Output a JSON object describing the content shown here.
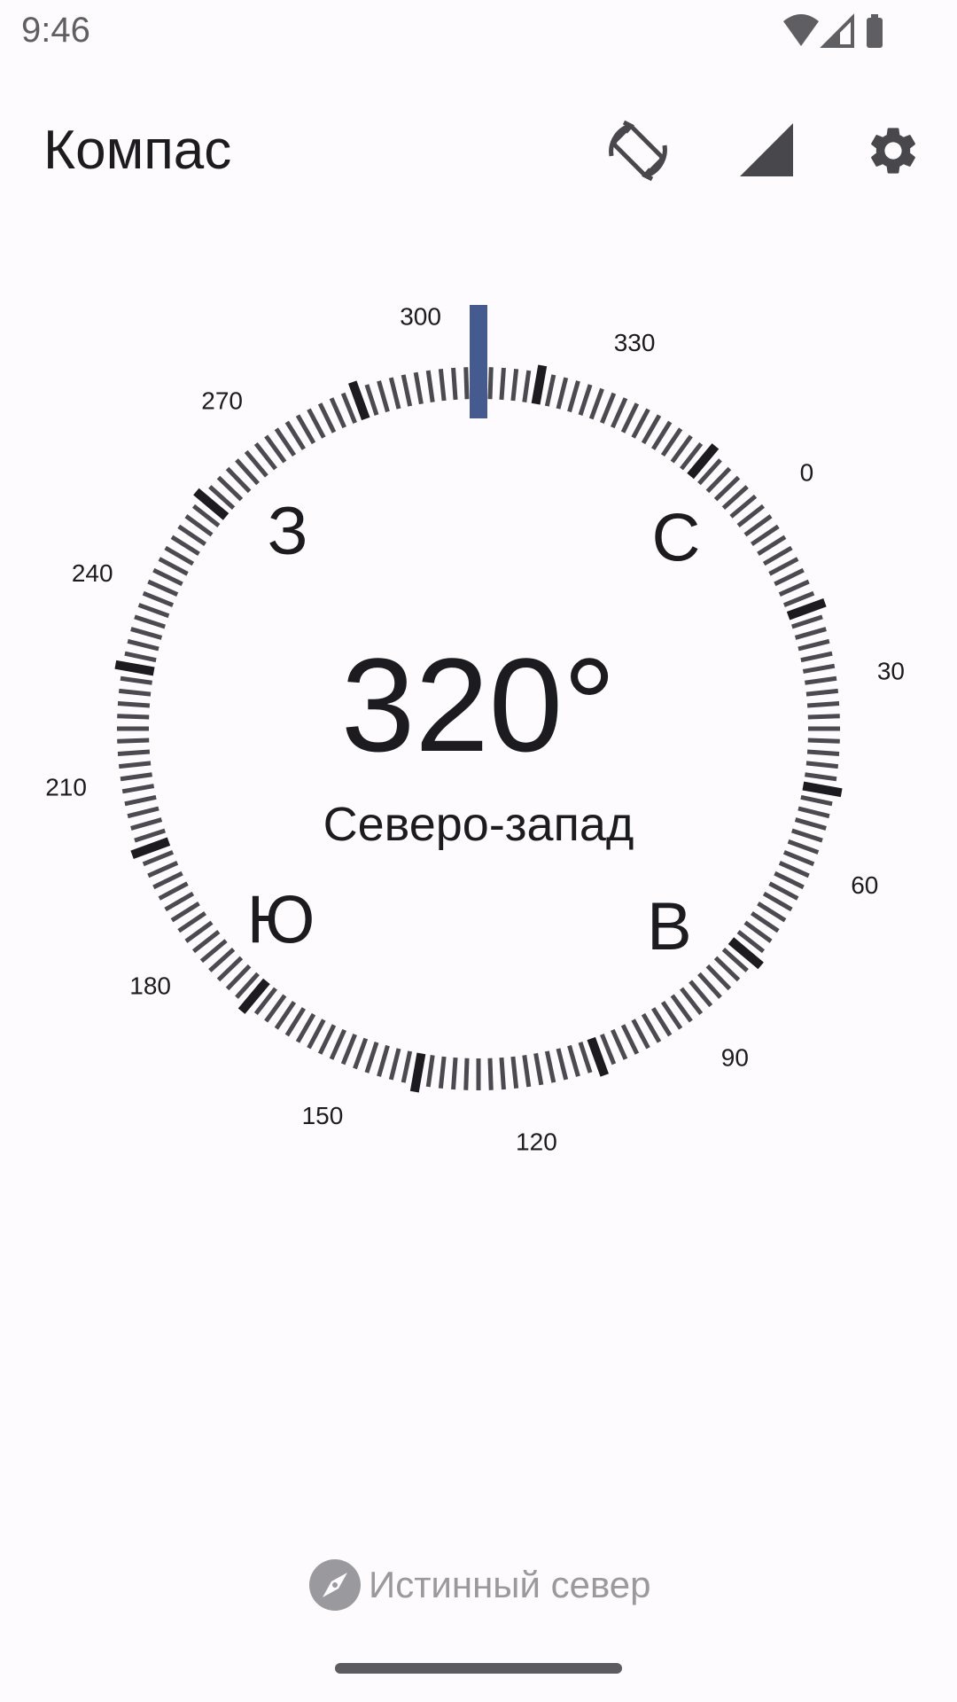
{
  "status_bar": {
    "time": "9:46",
    "icons": [
      "wifi-icon",
      "cell-signal-icon",
      "battery-icon"
    ]
  },
  "app_bar": {
    "title": "Компас",
    "actions": [
      "screen-rotation-icon",
      "cell-signal-icon",
      "gear-icon"
    ]
  },
  "compass": {
    "heading": "320°",
    "heading_degrees": 320,
    "direction": "Северо-запад",
    "dial_labels": [
      "0",
      "30",
      "60",
      "90",
      "120",
      "150",
      "180",
      "210",
      "240",
      "270",
      "300",
      "330"
    ],
    "cardinals": {
      "north": "С",
      "east": "В",
      "south": "Ю",
      "west": "З"
    },
    "pointer_color": "#455a8f",
    "tick_color": "#4a4a50",
    "major_tick_color": "#1c1b1f"
  },
  "true_north": {
    "label": "Истинный север",
    "icon": "compass-icon",
    "color": "#9a999d"
  }
}
